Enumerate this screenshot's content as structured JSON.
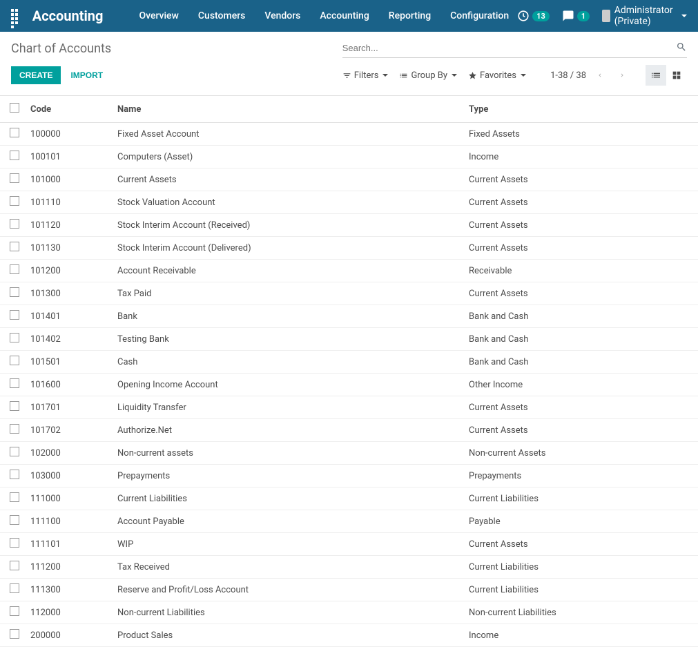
{
  "nav": {
    "brand": "Accounting",
    "menu": [
      "Overview",
      "Customers",
      "Vendors",
      "Accounting",
      "Reporting",
      "Configuration"
    ],
    "clock_badge": "13",
    "chat_badge": "1",
    "user": "Administrator (Private)"
  },
  "breadcrumb": "Chart of Accounts",
  "search": {
    "placeholder": "Search..."
  },
  "buttons": {
    "create": "CREATE",
    "import": "IMPORT"
  },
  "filters": {
    "filters": "Filters",
    "groupby": "Group By",
    "favorites": "Favorites"
  },
  "pager": "1-38 / 38",
  "table": {
    "headers": {
      "code": "Code",
      "name": "Name",
      "type": "Type"
    },
    "rows": [
      {
        "code": "100000",
        "name": "Fixed Asset Account",
        "type": "Fixed Assets"
      },
      {
        "code": "100101",
        "name": "Computers (Asset)",
        "type": "Income"
      },
      {
        "code": "101000",
        "name": "Current Assets",
        "type": "Current Assets"
      },
      {
        "code": "101110",
        "name": "Stock Valuation Account",
        "type": "Current Assets"
      },
      {
        "code": "101120",
        "name": "Stock Interim Account (Received)",
        "type": "Current Assets"
      },
      {
        "code": "101130",
        "name": "Stock Interim Account (Delivered)",
        "type": "Current Assets"
      },
      {
        "code": "101200",
        "name": "Account Receivable",
        "type": "Receivable"
      },
      {
        "code": "101300",
        "name": "Tax Paid",
        "type": "Current Assets"
      },
      {
        "code": "101401",
        "name": "Bank",
        "type": "Bank and Cash"
      },
      {
        "code": "101402",
        "name": "Testing Bank",
        "type": "Bank and Cash"
      },
      {
        "code": "101501",
        "name": "Cash",
        "type": "Bank and Cash"
      },
      {
        "code": "101600",
        "name": "Opening Income Account",
        "type": "Other Income"
      },
      {
        "code": "101701",
        "name": "Liquidity Transfer",
        "type": "Current Assets"
      },
      {
        "code": "101702",
        "name": "Authorize.Net",
        "type": "Current Assets"
      },
      {
        "code": "102000",
        "name": "Non-current assets",
        "type": "Non-current Assets"
      },
      {
        "code": "103000",
        "name": "Prepayments",
        "type": "Prepayments"
      },
      {
        "code": "111000",
        "name": "Current Liabilities",
        "type": "Current Liabilities"
      },
      {
        "code": "111100",
        "name": "Account Payable",
        "type": "Payable"
      },
      {
        "code": "111101",
        "name": "WIP",
        "type": "Current Assets"
      },
      {
        "code": "111200",
        "name": "Tax Received",
        "type": "Current Liabilities"
      },
      {
        "code": "111300",
        "name": "Reserve and Profit/Loss Account",
        "type": "Current Liabilities"
      },
      {
        "code": "112000",
        "name": "Non-current Liabilities",
        "type": "Non-current Liabilities"
      },
      {
        "code": "200000",
        "name": "Product Sales",
        "type": "Income"
      }
    ]
  }
}
